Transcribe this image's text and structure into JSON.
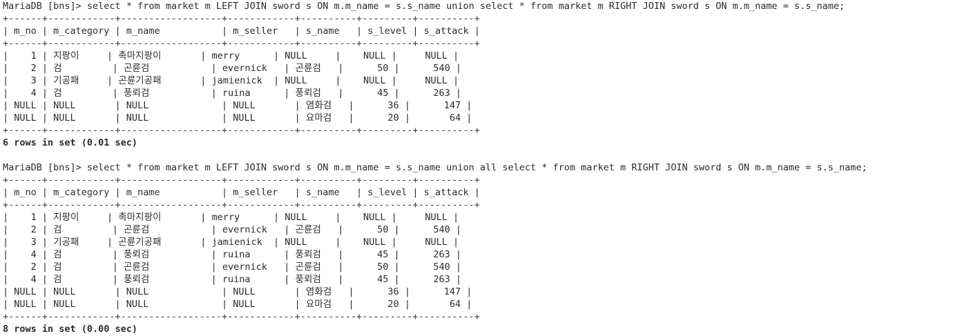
{
  "terminal": {
    "blocks": [
      {
        "prompt": "MariaDB [bns]> ",
        "command": "select * from market m LEFT JOIN sword s ON m.m_name = s.s_name union select * from market m RIGHT JOIN sword s ON m.m_name = s.s_name;",
        "border": "+------+------------+------------------+------------+----------+---------+----------+",
        "header": "| m_no | m_category | m_name           | m_seller   | s_name   | s_level | s_attack |",
        "rows": [
          "|    1 | 지팡이     | 촉마지팡이       | merry      | NULL     |    NULL |     NULL |",
          "|    2 | 검         | 곤륜검           | evernick   | 곤륜검   |      50 |      540 |",
          "|    3 | 기공패     | 곤륜기공패       | jamienick  | NULL     |    NULL |     NULL |",
          "|    4 | 검         | 풍뢰검           | ruina      | 풍뢰검   |      45 |      263 |",
          "| NULL | NULL       | NULL             | NULL       | 염화검   |      36 |      147 |",
          "| NULL | NULL       | NULL             | NULL       | 요마검   |      20 |       64 |"
        ],
        "result": "6 rows in set (0.01 sec)"
      },
      {
        "prompt": "MariaDB [bns]> ",
        "command": "select * from market m LEFT JOIN sword s ON m.m_name = s.s_name union all select * from market m RIGHT JOIN sword s ON m.m_name = s.s_name;",
        "border": "+------+------------+------------------+------------+----------+---------+----------+",
        "header": "| m_no | m_category | m_name           | m_seller   | s_name   | s_level | s_attack |",
        "rows": [
          "|    1 | 지팡이     | 촉마지팡이       | merry      | NULL     |    NULL |     NULL |",
          "|    2 | 검         | 곤륜검           | evernick   | 곤륜검   |      50 |      540 |",
          "|    3 | 기공패     | 곤륜기공패       | jamienick  | NULL     |    NULL |     NULL |",
          "|    4 | 검         | 풍뢰검           | ruina      | 풍뢰검   |      45 |      263 |",
          "|    2 | 검         | 곤륜검           | evernick   | 곤륜검   |      50 |      540 |",
          "|    4 | 검         | 풍뢰검           | ruina      | 풍뢰검   |      45 |      263 |",
          "| NULL | NULL       | NULL             | NULL       | 염화검   |      36 |      147 |",
          "| NULL | NULL       | NULL             | NULL       | 요마검   |      20 |       64 |"
        ],
        "result": "8 rows in set (0.00 sec)"
      }
    ]
  }
}
